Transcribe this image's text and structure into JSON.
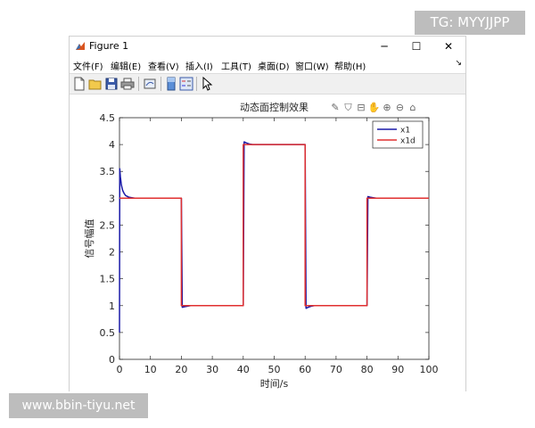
{
  "window": {
    "title": "Figure 1",
    "controls": {
      "minimize": "─",
      "maximize": "☐",
      "close": "✕"
    }
  },
  "menubar": {
    "items": [
      "文件(F)",
      "编辑(E)",
      "查看(V)",
      "插入(I)",
      "工具(T)",
      "桌面(D)",
      "窗口(W)",
      "帮助(H)"
    ],
    "overflow_glyph": "↘"
  },
  "toolbar": {
    "icons": [
      "new-figure-icon",
      "open-file-icon",
      "save-icon",
      "print-icon",
      "link-plot-icon",
      "insert-colorbar-icon",
      "insert-legend-icon",
      "pointer-icon"
    ]
  },
  "axes_toolbar": {
    "icons": [
      "brush-icon",
      "data-tips-icon",
      "export-icon",
      "pan-icon",
      "zoom-in-icon",
      "zoom-out-icon",
      "home-icon"
    ]
  },
  "watermarks": {
    "top_right": "TG: MYYJJPP",
    "bottom_left": "www.bbin-tiyu.net"
  },
  "chart_data": {
    "type": "line",
    "title": "动态面控制效果",
    "xlabel": "时间/s",
    "ylabel": "信号幅值",
    "xlim": [
      0,
      100
    ],
    "ylim": [
      0,
      4.5
    ],
    "xticks": [
      "0",
      "10",
      "20",
      "30",
      "40",
      "50",
      "60",
      "70",
      "80",
      "90",
      "100"
    ],
    "yticks": [
      "0",
      "0.5",
      "1",
      "1.5",
      "2",
      "2.5",
      "3",
      "3.5",
      "4",
      "4.5"
    ],
    "legend_position": "top-right",
    "grid": false,
    "series": [
      {
        "name": "x1",
        "color": "#1a1aa8",
        "x": [
          0,
          0.1,
          0.3,
          0.6,
          1,
          1.5,
          2,
          3,
          4,
          5,
          20,
          20.3,
          21,
          22,
          23,
          40,
          40.3,
          41,
          42,
          43,
          60,
          60.3,
          61,
          62,
          63,
          80,
          80.3,
          81,
          82,
          83,
          100
        ],
        "y": [
          0.5,
          3.55,
          3.4,
          3.25,
          3.15,
          3.09,
          3.05,
          3.02,
          3.01,
          3.0,
          3.0,
          0.97,
          0.98,
          0.99,
          1.0,
          1.0,
          4.05,
          4.03,
          4.01,
          4.0,
          4.0,
          0.95,
          0.97,
          0.99,
          1.0,
          1.0,
          3.03,
          3.02,
          3.01,
          3.0,
          3.0
        ]
      },
      {
        "name": "x1d",
        "color": "#e03030",
        "x": [
          0,
          20,
          20,
          40,
          40,
          60,
          60,
          80,
          80,
          100
        ],
        "y": [
          3,
          3,
          1,
          1,
          4,
          4,
          1,
          1,
          3,
          3
        ]
      }
    ]
  }
}
